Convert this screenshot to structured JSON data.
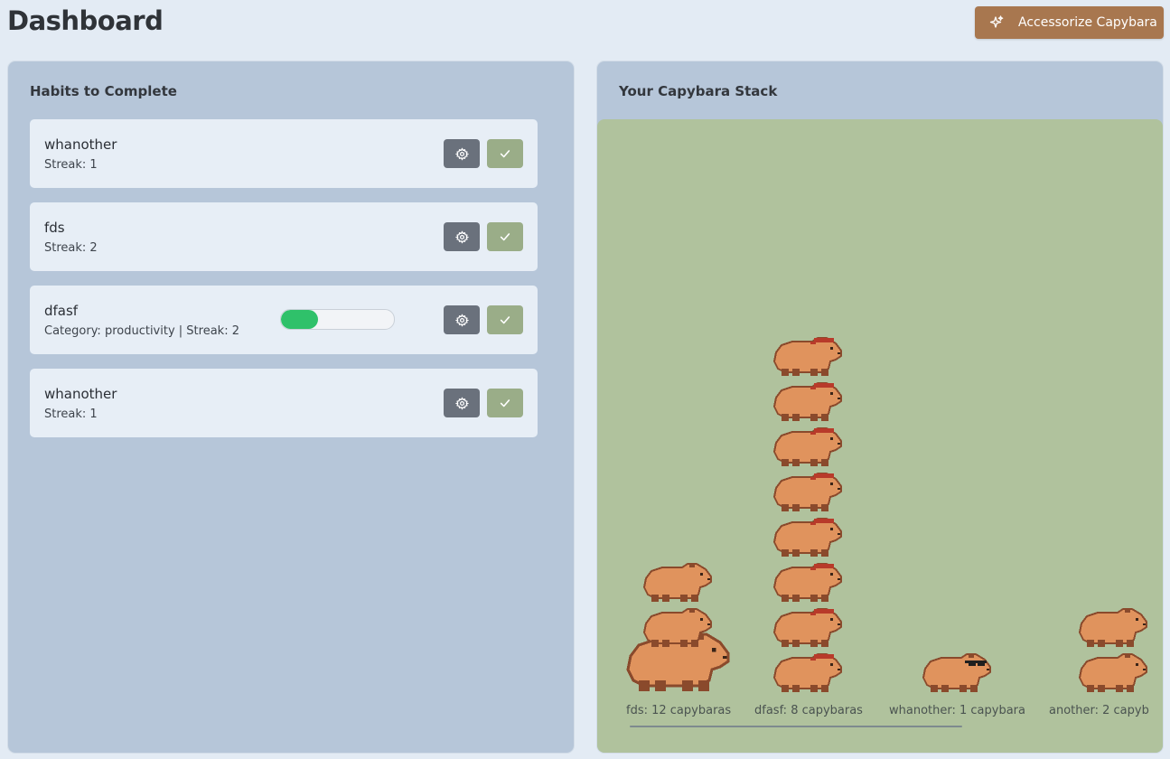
{
  "header": {
    "title": "Dashboard",
    "accessorize_label": "Accessorize Capybara",
    "accessorize_icon": "sparkles-icon"
  },
  "habits_panel": {
    "title": "Habits to Complete",
    "habits": [
      {
        "name": "whanother",
        "meta": "Streak: 1"
      },
      {
        "name": "fds",
        "meta": "Streak: 2"
      },
      {
        "name": "dfasf",
        "meta": "Category: productivity | Streak: 2",
        "progress_percent": 33
      },
      {
        "name": "whanother",
        "meta": "Streak: 1"
      }
    ],
    "settings_icon": "gear-icon",
    "complete_icon": "check-icon"
  },
  "stack_panel": {
    "title": "Your Capybara Stack",
    "stacks": [
      {
        "label": "fds: 12 capybaras",
        "shown": 3
      },
      {
        "label": "dfasf: 8 capybaras",
        "shown": 8,
        "accessory": "red-headband"
      },
      {
        "label": "whanother: 1 capybara",
        "shown": 1,
        "accessory": "sunglasses"
      },
      {
        "label": "another: 2 capyb",
        "shown": 2
      }
    ]
  },
  "colors": {
    "background": "#e3ebf4",
    "panel": "#b6c6d9",
    "stack_area": "#b0c29d",
    "accent_brown": "#a8774f",
    "settings_button": "#6a717c",
    "complete_button": "#9aad88",
    "progress_fill": "#2fc16a",
    "capybara": "#e0935d"
  }
}
